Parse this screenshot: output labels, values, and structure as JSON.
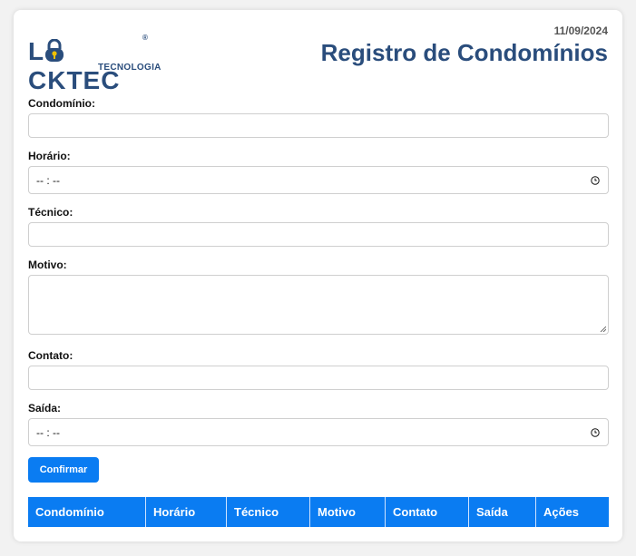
{
  "header": {
    "date": "11/09/2024",
    "title": "Registro de Condomínios",
    "logo_main": "LOCKTEC",
    "logo_sub": "TECNOLOGIA",
    "logo_registered": "®"
  },
  "form": {
    "condominio_label": "Condomínio:",
    "condominio_value": "",
    "horario_label": "Horário:",
    "horario_value": "-- : --",
    "tecnico_label": "Técnico:",
    "tecnico_value": "",
    "motivo_label": "Motivo:",
    "motivo_value": "",
    "contato_label": "Contato:",
    "contato_value": "",
    "saida_label": "Saída:",
    "saida_value": "-- : --",
    "confirm_label": "Confirmar"
  },
  "table": {
    "headers": [
      "Condomínio",
      "Horário",
      "Técnico",
      "Motivo",
      "Contato",
      "Saída",
      "Ações"
    ]
  },
  "colors": {
    "accent": "#0a7cf2",
    "title": "#2a4d7c",
    "lock_keyhole": "#f2c100"
  },
  "icons": [
    "lock-logo-icon",
    "clock-icon",
    "resize-handle-icon"
  ]
}
